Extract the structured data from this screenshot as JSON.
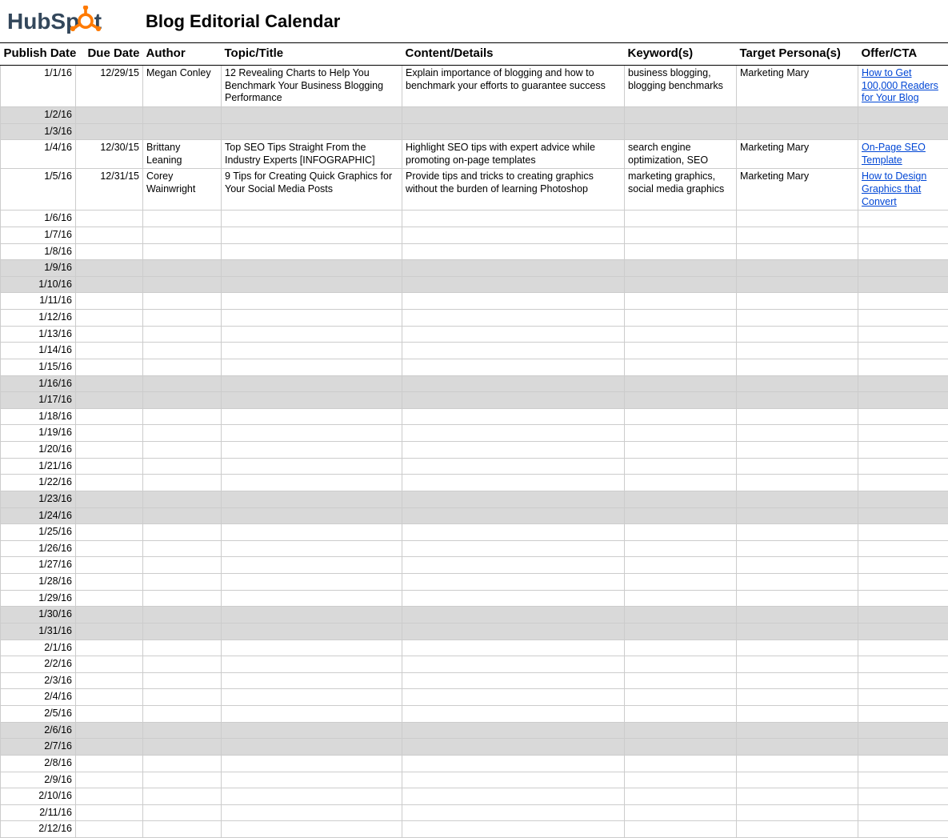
{
  "brand": "HubSpot",
  "title": "Blog Editorial Calendar",
  "columns": [
    "Publish Date",
    "Due Date",
    "Author",
    "Topic/Title",
    "Content/Details",
    "Keyword(s)",
    "Target Persona(s)",
    "Offer/CTA"
  ],
  "rows": [
    {
      "publish": "1/1/16",
      "due": "12/29/15",
      "author": "Megan Conley",
      "topic": "12 Revealing Charts to Help You Benchmark Your Business Blogging Performance",
      "content": "Explain importance of blogging and how to benchmark your efforts to guarantee success",
      "keywords": "business blogging, blogging benchmarks",
      "persona": "Marketing Mary",
      "offer": "How to Get 100,000 Readers for Your Blog",
      "shaded": false
    },
    {
      "publish": "1/2/16",
      "shaded": true
    },
    {
      "publish": "1/3/16",
      "shaded": true
    },
    {
      "publish": "1/4/16",
      "due": "12/30/15",
      "author": "Brittany Leaning",
      "topic": "Top SEO Tips Straight From the Industry Experts [INFOGRAPHIC]",
      "content": "Highlight SEO tips with expert advice while promoting on-page templates",
      "keywords": "search engine optimization, SEO",
      "persona": "Marketing Mary",
      "offer": "On-Page SEO Template",
      "shaded": false
    },
    {
      "publish": "1/5/16",
      "due": "12/31/15",
      "author": "Corey Wainwright",
      "topic": "9 Tips for Creating Quick Graphics for Your Social Media Posts",
      "content": "Provide tips and tricks to creating graphics without the burden of learning Photoshop",
      "keywords": "marketing graphics, social media graphics",
      "persona": "Marketing Mary",
      "offer": "How to Design Graphics that Convert",
      "shaded": false
    },
    {
      "publish": "1/6/16",
      "shaded": false
    },
    {
      "publish": "1/7/16",
      "shaded": false
    },
    {
      "publish": "1/8/16",
      "shaded": false
    },
    {
      "publish": "1/9/16",
      "shaded": true
    },
    {
      "publish": "1/10/16",
      "shaded": true
    },
    {
      "publish": "1/11/16",
      "shaded": false
    },
    {
      "publish": "1/12/16",
      "shaded": false
    },
    {
      "publish": "1/13/16",
      "shaded": false
    },
    {
      "publish": "1/14/16",
      "shaded": false
    },
    {
      "publish": "1/15/16",
      "shaded": false
    },
    {
      "publish": "1/16/16",
      "shaded": true
    },
    {
      "publish": "1/17/16",
      "shaded": true
    },
    {
      "publish": "1/18/16",
      "shaded": false
    },
    {
      "publish": "1/19/16",
      "shaded": false
    },
    {
      "publish": "1/20/16",
      "shaded": false
    },
    {
      "publish": "1/21/16",
      "shaded": false
    },
    {
      "publish": "1/22/16",
      "shaded": false
    },
    {
      "publish": "1/23/16",
      "shaded": true
    },
    {
      "publish": "1/24/16",
      "shaded": true
    },
    {
      "publish": "1/25/16",
      "shaded": false
    },
    {
      "publish": "1/26/16",
      "shaded": false
    },
    {
      "publish": "1/27/16",
      "shaded": false
    },
    {
      "publish": "1/28/16",
      "shaded": false
    },
    {
      "publish": "1/29/16",
      "shaded": false
    },
    {
      "publish": "1/30/16",
      "shaded": true
    },
    {
      "publish": "1/31/16",
      "shaded": true
    },
    {
      "publish": "2/1/16",
      "shaded": false
    },
    {
      "publish": "2/2/16",
      "shaded": false
    },
    {
      "publish": "2/3/16",
      "shaded": false
    },
    {
      "publish": "2/4/16",
      "shaded": false
    },
    {
      "publish": "2/5/16",
      "shaded": false
    },
    {
      "publish": "2/6/16",
      "shaded": true
    },
    {
      "publish": "2/7/16",
      "shaded": true
    },
    {
      "publish": "2/8/16",
      "shaded": false
    },
    {
      "publish": "2/9/16",
      "shaded": false
    },
    {
      "publish": "2/10/16",
      "shaded": false
    },
    {
      "publish": "2/11/16",
      "shaded": false
    },
    {
      "publish": "2/12/16",
      "shaded": false
    }
  ]
}
